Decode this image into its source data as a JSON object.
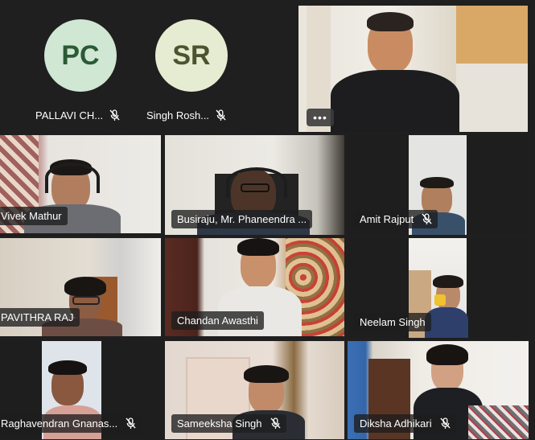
{
  "colors": {
    "background": "#1f1f1f",
    "active_speaker_border": "#8f8fe6",
    "avatar_pc_bg": "#cfe7d3",
    "avatar_pc_text": "#2b5a36",
    "avatar_sr_bg": "#e6ecd2",
    "avatar_sr_text": "#4a5530"
  },
  "participants": [
    {
      "initials": "PC",
      "name": "PALLAVI CH...",
      "muted": true,
      "video": false
    },
    {
      "initials": "SR",
      "name": "Singh Rosh...",
      "muted": true,
      "video": false
    },
    {
      "name": "",
      "muted": false,
      "video": true,
      "more_label": "•••"
    },
    {
      "name": "Vivek Mathur",
      "muted": false,
      "video": true,
      "active": true
    },
    {
      "name": "Busiraju, Mr. Phaneendra ...",
      "muted": false,
      "video": true
    },
    {
      "name": "Amit Rajput",
      "muted": true,
      "video": true
    },
    {
      "name": "PAVITHRA RAJ",
      "muted": false,
      "video": true
    },
    {
      "name": "Chandan Awasthi",
      "muted": false,
      "video": true
    },
    {
      "name": "Neelam Singh",
      "muted": false,
      "video": true
    },
    {
      "name": "Raghavendran Gnanas...",
      "muted": true,
      "video": true
    },
    {
      "name": "Sameeksha Singh",
      "muted": true,
      "video": true
    },
    {
      "name": "Diksha Adhikari",
      "muted": true,
      "video": true
    }
  ]
}
